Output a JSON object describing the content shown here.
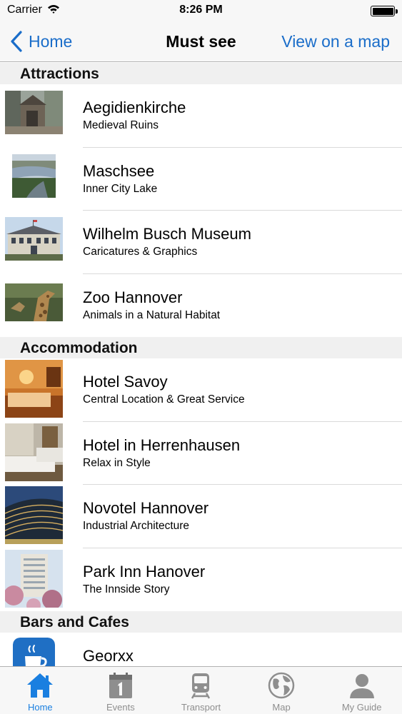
{
  "status_bar": {
    "carrier": "Carrier",
    "time": "8:26 PM"
  },
  "nav": {
    "back_label": "Home",
    "title": "Must see",
    "action_label": "View on a map"
  },
  "sections": [
    {
      "title": "Attractions",
      "items": [
        {
          "title": "Aegidienkirche",
          "subtitle": "Medieval Ruins"
        },
        {
          "title": "Maschsee",
          "subtitle": "Inner City Lake"
        },
        {
          "title": "Wilhelm Busch Museum",
          "subtitle": "Caricatures & Graphics"
        },
        {
          "title": "Zoo Hannover",
          "subtitle": "Animals in a Natural Habitat"
        }
      ]
    },
    {
      "title": "Accommodation",
      "items": [
        {
          "title": "Hotel Savoy",
          "subtitle": "Central Location & Great Service"
        },
        {
          "title": "Hotel in Herrenhausen",
          "subtitle": "Relax in Style"
        },
        {
          "title": "Novotel Hannover",
          "subtitle": "Industrial Architecture"
        },
        {
          "title": "Park Inn Hanover",
          "subtitle": "The Innside Story"
        }
      ]
    },
    {
      "title": "Bars and Cafes",
      "items": [
        {
          "title": "Georxx",
          "subtitle": ""
        }
      ]
    }
  ],
  "tabs": [
    {
      "label": "Home",
      "icon": "home-icon",
      "active": true
    },
    {
      "label": "Events",
      "icon": "calendar-icon",
      "active": false
    },
    {
      "label": "Transport",
      "icon": "train-icon",
      "active": false
    },
    {
      "label": "Map",
      "icon": "globe-icon",
      "active": false
    },
    {
      "label": "My Guide",
      "icon": "person-icon",
      "active": false
    }
  ],
  "colors": {
    "accent": "#1a6dc9",
    "tab_active": "#1a7fe0",
    "section_bg": "#f0f0f0"
  }
}
